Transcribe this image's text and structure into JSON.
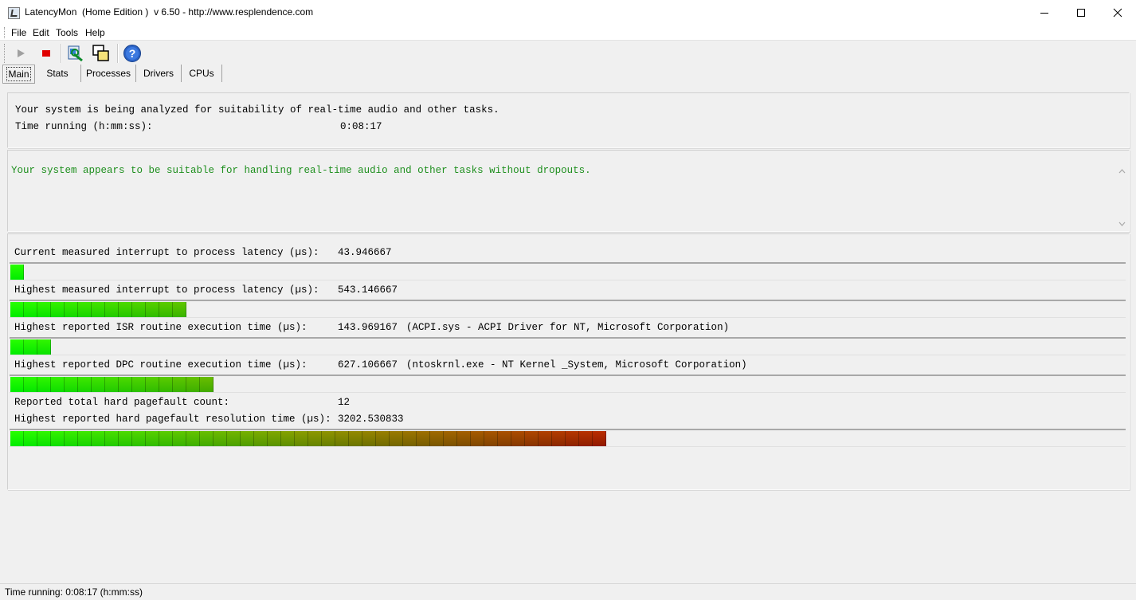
{
  "window": {
    "title": "LatencyMon  (Home Edition )  v 6.50 - http://www.resplendence.com"
  },
  "menu": [
    "File",
    "Edit",
    "Tools",
    "Help"
  ],
  "toolbar": {
    "icons": [
      "play-icon",
      "stop-icon",
      "report-icon",
      "windows-icon",
      "help-icon"
    ]
  },
  "tabs": [
    "Main",
    "Stats",
    "Processes",
    "Drivers",
    "CPUs"
  ],
  "status_panel": {
    "message": "Your system is being analyzed for suitability of real-time audio and other tasks.",
    "time_label": "Time running (h:mm:ss):",
    "time_value": "0:08:17"
  },
  "result": {
    "message": "Your system appears to be suitable for handling real-time audio and other tasks without dropouts.",
    "color": "#1e8f1e"
  },
  "metrics": [
    {
      "label": "Current measured interrupt to process latency (µs):",
      "value": "43.946667",
      "detail": "",
      "bar_segments": 1
    },
    {
      "label": "Highest measured interrupt to process latency (µs):",
      "value": "543.146667",
      "detail": "",
      "bar_segments": 13
    },
    {
      "label": "Highest reported ISR routine execution time (µs):",
      "value": "143.969167",
      "detail": "(ACPI.sys - ACPI Driver for NT, Microsoft Corporation)",
      "bar_segments": 3
    },
    {
      "label": "Highest reported DPC routine execution time (µs):",
      "value": "627.106667",
      "detail": "(ntoskrnl.exe - NT Kernel _System, Microsoft Corporation)",
      "bar_segments": 15
    },
    {
      "label": "Reported total hard pagefault count:",
      "value": "12",
      "detail": "",
      "bar_segments": 0
    },
    {
      "label": "Highest reported hard pagefault resolution time (µs):",
      "value": "3202.530833",
      "detail": "",
      "bar_segments": 44
    }
  ],
  "statusbar": {
    "text": "Time running: 0:08:17  (h:mm:ss)"
  }
}
